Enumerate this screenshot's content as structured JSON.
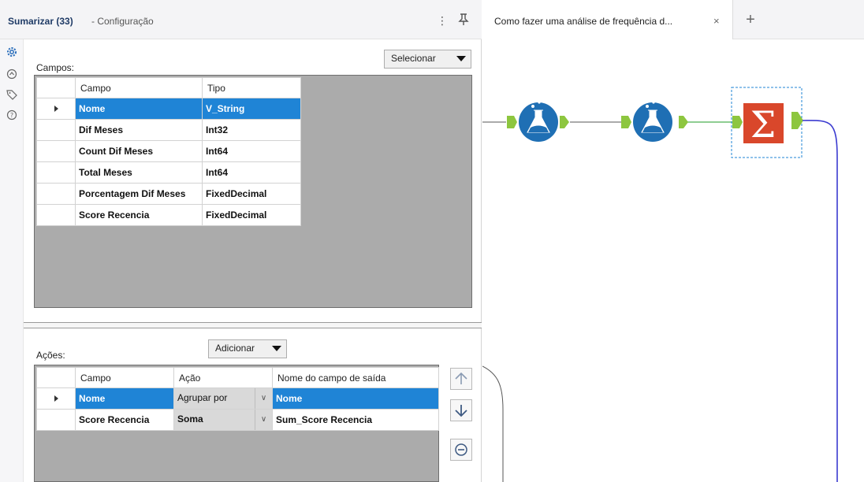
{
  "panel": {
    "title": "Sumarizar (33)",
    "subtitle": "- Configuração",
    "menu_icon": "kebab-menu-icon",
    "pin_icon": "pin-icon"
  },
  "rail_icons": [
    "gear-icon",
    "tool-icon",
    "tag-icon",
    "help-icon"
  ],
  "fields": {
    "label": "Campos:",
    "select_button": "Selecionar",
    "columns": [
      "Campo",
      "Tipo"
    ],
    "rows": [
      {
        "campo": "Nome",
        "tipo": "V_String",
        "selected": true
      },
      {
        "campo": "Dif Meses",
        "tipo": "Int32"
      },
      {
        "campo": "Count Dif Meses",
        "tipo": "Int64"
      },
      {
        "campo": "Total Meses",
        "tipo": "Int64"
      },
      {
        "campo": "Porcentagem Dif Meses",
        "tipo": "FixedDecimal"
      },
      {
        "campo": "Score Recencia",
        "tipo": "FixedDecimal"
      }
    ]
  },
  "actions": {
    "label": "Ações:",
    "add_button": "Adicionar",
    "columns": [
      "Campo",
      "Ação",
      "Nome do campo de saída"
    ],
    "rows": [
      {
        "campo": "Nome",
        "acao": "Agrupar por",
        "saida": "Nome",
        "selected": true
      },
      {
        "campo": "Score Recencia",
        "acao": "Soma",
        "saida": "Sum_Score Recencia"
      }
    ],
    "move_up_icon": "arrow-up-icon",
    "move_down_icon": "arrow-down-icon",
    "remove_icon": "remove-icon"
  },
  "canvas": {
    "tab_label": "Como fazer uma análise de frequência d...",
    "close_icon": "×",
    "add_tab": "+",
    "selection_color": "#1f84d6",
    "tool_blue": "#1f6fb4",
    "summarize_orange": "#d9472b",
    "anchor_green": "#8dc63f",
    "connection_blue": "#3b3bd0"
  }
}
